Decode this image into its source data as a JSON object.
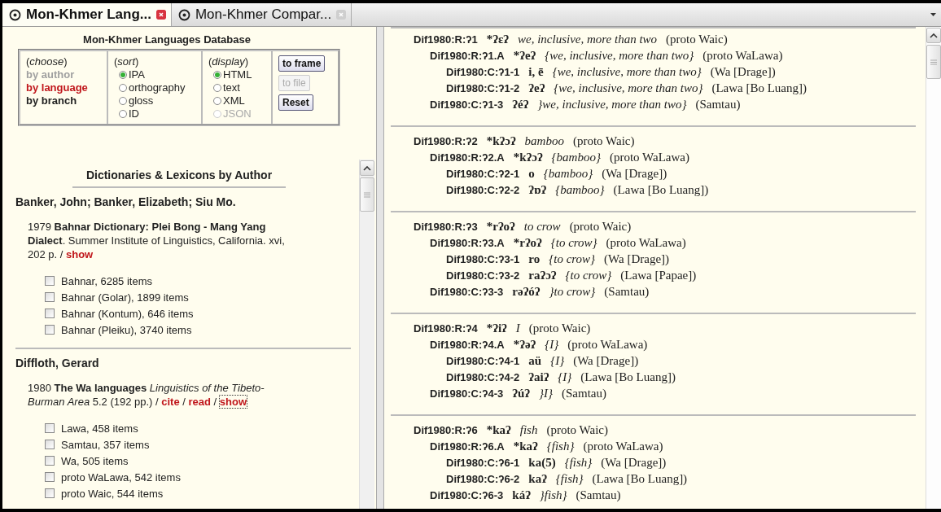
{
  "tabs": [
    {
      "label": "Mon-Khmer Lang...",
      "selected": true
    },
    {
      "label": "Mon-Khmer Compar...",
      "selected": false
    }
  ],
  "query_form": {
    "title": "Mon-Khmer Languages Database",
    "choose": {
      "heading": "(*choose*)",
      "options": [
        {
          "label": "by author",
          "selected": false,
          "disabled": true
        },
        {
          "label": "by language",
          "selected": true,
          "disabled": false
        },
        {
          "label": "by branch",
          "selected": false,
          "disabled": false
        }
      ]
    },
    "sort": {
      "heading": "(*sort*)",
      "options": [
        {
          "label": "IPA",
          "selected": true,
          "disabled": false
        },
        {
          "label": "orthography",
          "selected": false,
          "disabled": false
        },
        {
          "label": "gloss",
          "selected": false,
          "disabled": false
        },
        {
          "label": "ID",
          "selected": false,
          "disabled": false
        }
      ]
    },
    "display": {
      "heading": "(*display*)",
      "options": [
        {
          "label": "HTML",
          "selected": true,
          "disabled": false
        },
        {
          "label": "text",
          "selected": false,
          "disabled": false
        },
        {
          "label": "XML",
          "selected": false,
          "disabled": false
        },
        {
          "label": "JSON",
          "selected": false,
          "disabled": true
        }
      ]
    },
    "buttons": [
      {
        "label": "to frame",
        "disabled": false
      },
      {
        "label": "to file",
        "disabled": true
      },
      {
        "label": "Reset",
        "disabled": false
      }
    ]
  },
  "bibliography": {
    "title": "Dictionaries & Lexicons by Author",
    "authors": [
      {
        "name": "Banker, John; Banker, Elizabeth; Siu Mo.",
        "works": [
          {
            "citation": "1979 **Bahnar Dictionary: Plei Bong - Mang Yang Dialect**. Summer Institute of Linguistics, California. xvi, 202 p. / ",
            "links": [
              {
                "label": "show",
                "focused": false
              }
            ],
            "lexicons": [
              {
                "label": "Bahnar, 6285 items",
                "checked": false
              },
              {
                "label": "Bahnar (Golar), 1899 items",
                "checked": false
              },
              {
                "label": "Bahnar (Kontum), 646 items",
                "checked": false
              },
              {
                "label": "Bahnar (Pleiku), 3740 items",
                "checked": false
              }
            ]
          }
        ]
      },
      {
        "name": "Diffloth, Gerard",
        "works": [
          {
            "citation": "1980 **The Wa languages** *Linguistics of the Tibeto-Burman Area* 5.2 (192 pp.) / ",
            "links": [
              {
                "label": "cite",
                "after": " / ",
                "focused": false
              },
              {
                "label": "read",
                "after": " / ",
                "focused": false
              },
              {
                "label": "show",
                "focused": true
              }
            ],
            "lexicons": [
              {
                "label": "Lawa, 458 items",
                "checked": false
              },
              {
                "label": "Samtau, 357 items",
                "checked": false
              },
              {
                "label": "Wa, 505 items",
                "checked": false
              },
              {
                "label": "proto WaLawa, 542 items",
                "checked": false
              },
              {
                "label": "proto Waic, 544 items",
                "checked": false
              }
            ]
          }
        ]
      }
    ]
  },
  "entries": [
    {
      "id": "Dif1980:R:ʔ1",
      "form": "*ʔɛʔ",
      "gloss": "we, inclusive, more than two",
      "source": "(proto Waic)",
      "children": [
        {
          "id": "Dif1980:R:ʔ1.A",
          "form": "*ʔeʔ",
          "gloss": "{we, inclusive, more than two}",
          "source": "(proto WaLawa)",
          "children": [
            {
              "id": "Dif1980:C:ʔ1-1",
              "form": "i, ē",
              "gloss": "{we, inclusive, more than two}",
              "source": "(Wa [Drage])"
            },
            {
              "id": "Dif1980:C:ʔ1-2",
              "form": "ʔeʔ",
              "gloss": "{we, inclusive, more than two}",
              "source": "(Lawa [Bo Luang])"
            }
          ]
        },
        {
          "id": "Dif1980:C:ʔ1-3",
          "form": "ʔéʔ",
          "gloss": "}we, inclusive, more than two}",
          "source": "(Samtau)"
        }
      ]
    },
    {
      "id": "Dif1980:R:ʔ2",
      "form": "*kʔɔʔ",
      "gloss": "bamboo",
      "source": "(proto Waic)",
      "children": [
        {
          "id": "Dif1980:R:ʔ2.A",
          "form": "*kʔɔʔ",
          "gloss": "{bamboo}",
          "source": "(proto WaLawa)",
          "children": [
            {
              "id": "Dif1980:C:ʔ2-1",
              "form": "o",
              "gloss": "{bamboo}",
              "source": "(Wa [Drage])"
            },
            {
              "id": "Dif1980:C:ʔ2-2",
              "form": "ʔɒʔ",
              "gloss": "{bamboo}",
              "source": "(Lawa [Bo Luang])"
            }
          ]
        }
      ]
    },
    {
      "id": "Dif1980:R:ʔ3",
      "form": "*rʔoʔ",
      "gloss": "to crow",
      "source": "(proto Waic)",
      "children": [
        {
          "id": "Dif1980:R:ʔ3.A",
          "form": "*rʔoʔ",
          "gloss": "{to crow}",
          "source": "(proto WaLawa)",
          "children": [
            {
              "id": "Dif1980:C:ʔ3-1",
              "form": "ro",
              "gloss": "{to crow}",
              "source": "(Wa [Drage])"
            },
            {
              "id": "Dif1980:C:ʔ3-2",
              "form": "raʔɔʔ",
              "gloss": "{to crow}",
              "source": "(Lawa [Papae])"
            }
          ]
        },
        {
          "id": "Dif1980:C:ʔ3-3",
          "form": "rəʔóʔ",
          "gloss": "}to crow}",
          "source": "(Samtau)"
        }
      ]
    },
    {
      "id": "Dif1980:R:ʔ4",
      "form": "*ʔiʔ",
      "gloss": "I",
      "source": "(proto Waic)",
      "children": [
        {
          "id": "Dif1980:R:ʔ4.A",
          "form": "*ʔəʔ",
          "gloss": "{I}",
          "source": "(proto WaLawa)",
          "children": [
            {
              "id": "Dif1980:C:ʔ4-1",
              "form": "aü",
              "gloss": "{I}",
              "source": "(Wa [Drage])"
            },
            {
              "id": "Dif1980:C:ʔ4-2",
              "form": "ʔaiʔ",
              "gloss": "{I}",
              "source": "(Lawa [Bo Luang])"
            }
          ]
        },
        {
          "id": "Dif1980:C:ʔ4-3",
          "form": "ʔúʔ",
          "gloss": "}I}",
          "source": "(Samtau)"
        }
      ]
    },
    {
      "id": "Dif1980:R:ʔ6",
      "form": "*kaʔ",
      "gloss": "fish",
      "source": "(proto Waic)",
      "children": [
        {
          "id": "Dif1980:R:ʔ6.A",
          "form": "*kaʔ",
          "gloss": "{fish}",
          "source": "(proto WaLawa)",
          "children": [
            {
              "id": "Dif1980:C:ʔ6-1",
              "form": "ka(5)",
              "gloss": "{fish}",
              "source": "(Wa [Drage])"
            },
            {
              "id": "Dif1980:C:ʔ6-2",
              "form": "kaʔ",
              "gloss": "{fish}",
              "source": "(Lawa [Bo Luang])"
            }
          ]
        },
        {
          "id": "Dif1980:C:ʔ6-3",
          "form": "káʔ",
          "gloss": "}fish}",
          "source": "(Samtau)"
        }
      ]
    }
  ]
}
